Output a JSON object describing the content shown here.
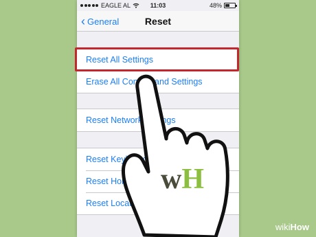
{
  "status": {
    "carrier": "EAGLE AL",
    "time": "11:03",
    "battery_text": "48%",
    "battery_level": 0.48
  },
  "nav": {
    "back_label": "General",
    "title": "Reset"
  },
  "groups": [
    [
      "Reset All Settings",
      "Erase All Content and Settings"
    ],
    [
      "Reset Network Settings"
    ],
    [
      "Reset Keyboard Dictionary",
      "Reset Home Screen Layout",
      "Reset Location & Privacy"
    ]
  ],
  "overlay": {
    "logo_text": "wH",
    "watermark_wiki": "wiki",
    "watermark_how": "How",
    "highlight_color": "#c1272d"
  },
  "colors": {
    "accent": "#1b7ef6",
    "page_bg": "#a8c98a",
    "ios_bg": "#efeff4",
    "logo_dark": "#4b4b3a",
    "logo_green": "#8cbf3f"
  }
}
